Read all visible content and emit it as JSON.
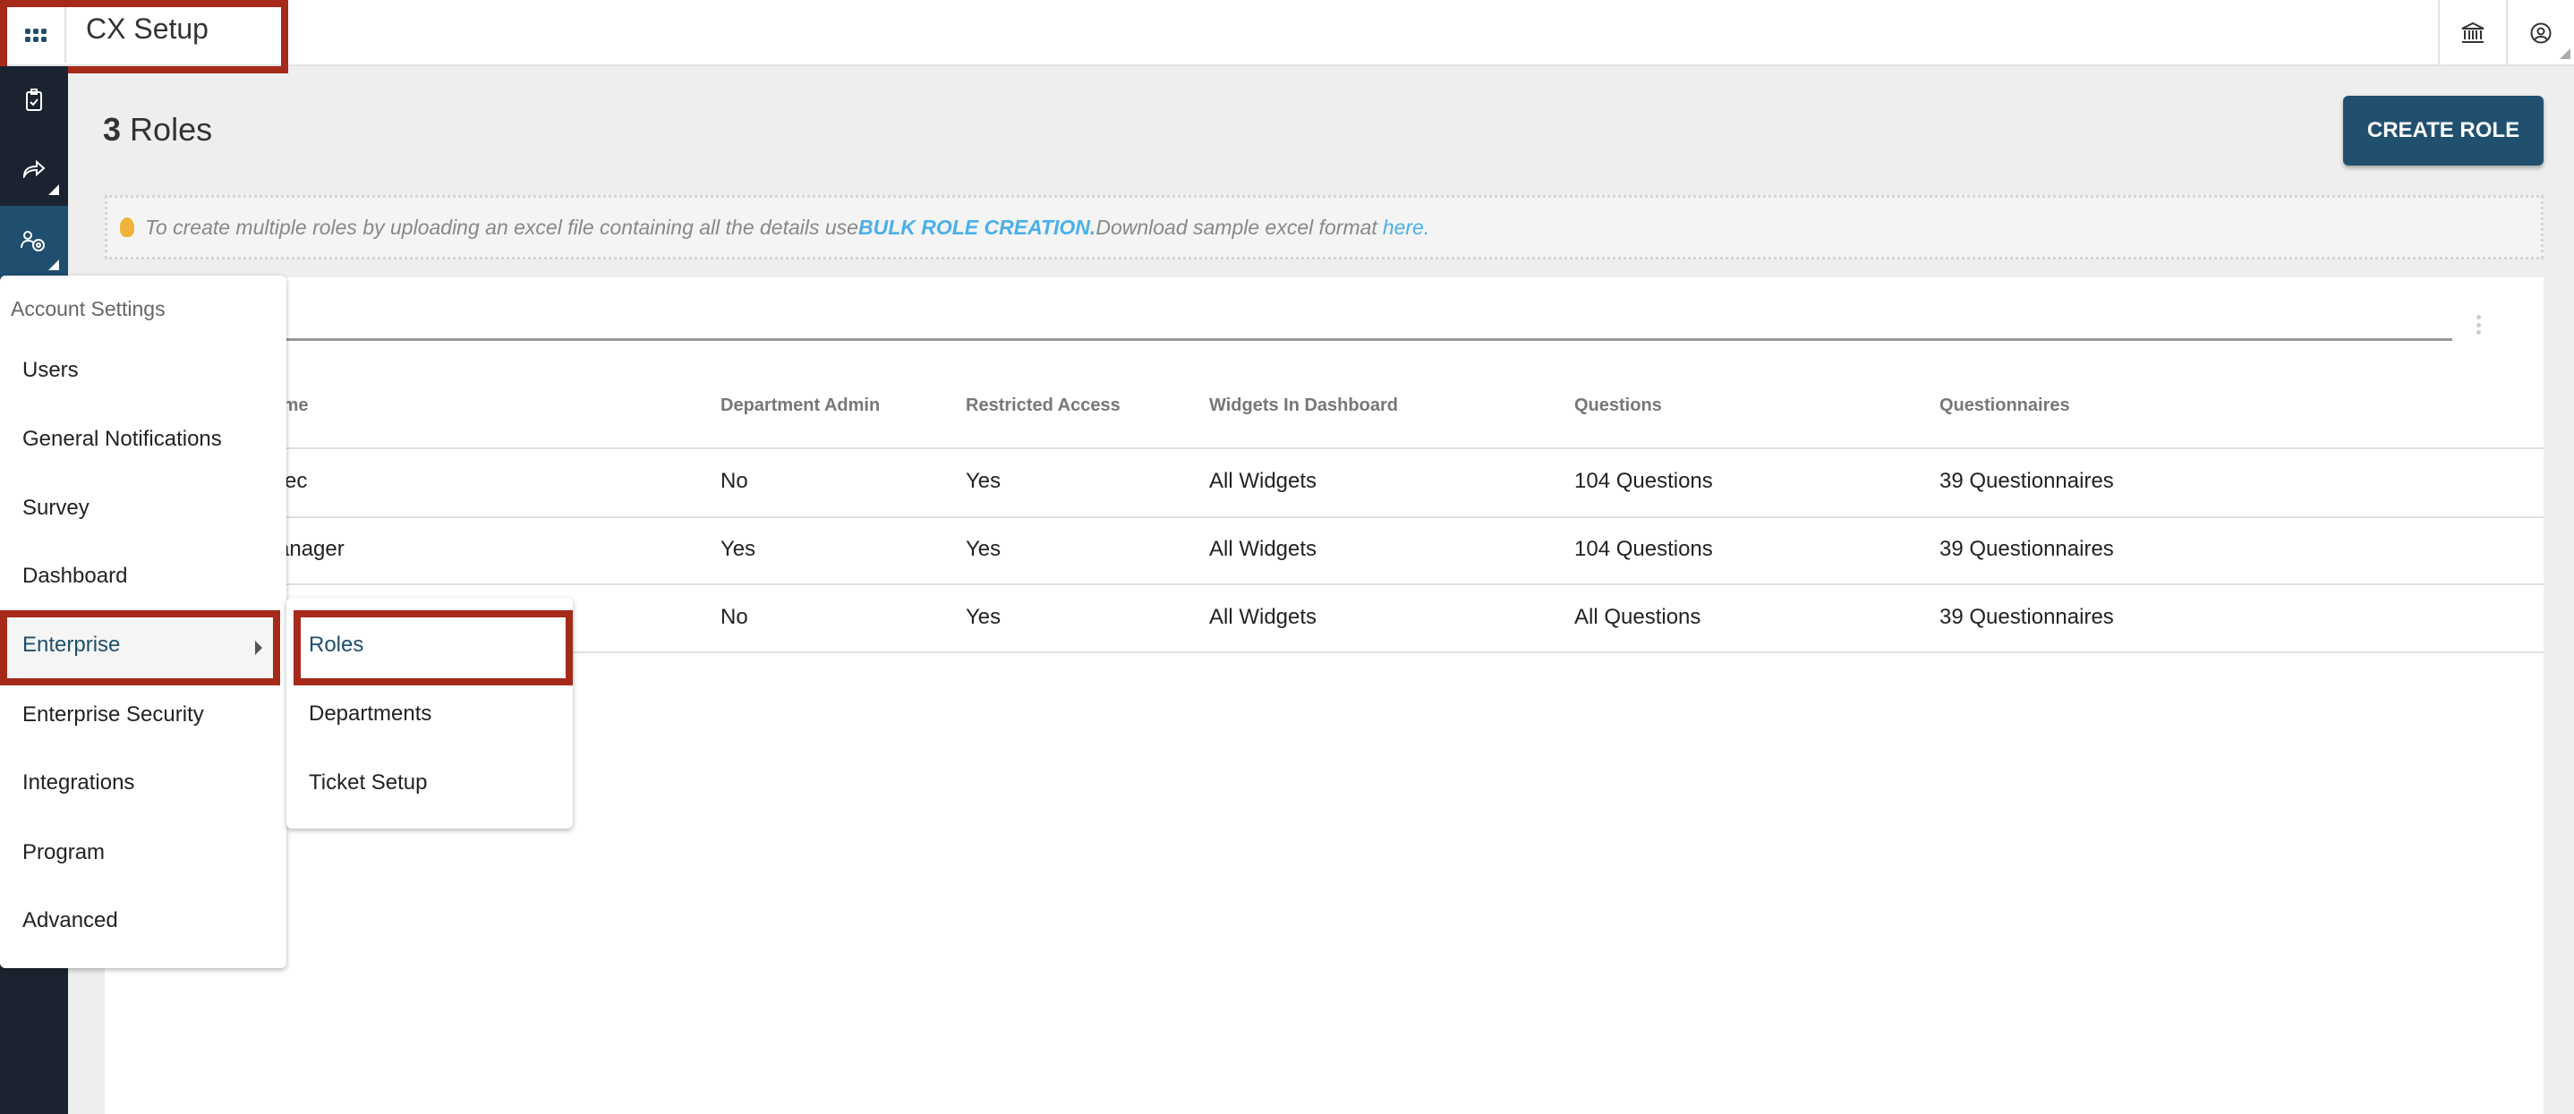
{
  "app": {
    "title": "CX Setup"
  },
  "page": {
    "count": "3",
    "title": "Roles",
    "create_button": "CREATE ROLE"
  },
  "info": {
    "text1": "To create multiple roles by uploading an excel file containing all the details use ",
    "bulk_link": "BULK ROLE CREATION.",
    "text2": "Download sample excel format ",
    "here_link": "here."
  },
  "table": {
    "headers": [
      "Name",
      "Department Admin",
      "Restricted Access",
      "Widgets In Dashboard",
      "Questions",
      "Questionnaires"
    ],
    "rows": [
      [
        "Exec",
        "No",
        "Yes",
        "All Widgets",
        "104 Questions",
        "39 Questionnaires"
      ],
      [
        "Manager",
        "Yes",
        "Yes",
        "All Widgets",
        "104 Questions",
        "39 Questionnaires"
      ],
      [
        "",
        "No",
        "Yes",
        "All Widgets",
        "All Questions",
        "39 Questionnaires"
      ]
    ]
  },
  "menu": {
    "header": "Account Settings",
    "items": [
      "Users",
      "General Notifications",
      "Survey",
      "Dashboard",
      "Enterprise",
      "Enterprise Security",
      "Integrations",
      "Program",
      "Advanced"
    ],
    "submenu": [
      "Roles",
      "Departments",
      "Ticket Setup"
    ]
  },
  "colors": {
    "primary": "#21506f",
    "sidebar": "#1c2330",
    "link": "#4ab0ea",
    "highlight": "#a52a1a",
    "bulb": "#f0b33a"
  },
  "icons": [
    "apps-grid-icon",
    "bank-icon",
    "user-circle-icon",
    "clipboard-check-icon",
    "share-forward-icon",
    "users-gear-icon",
    "lightbulb-icon",
    "kebab-menu-icon"
  ]
}
